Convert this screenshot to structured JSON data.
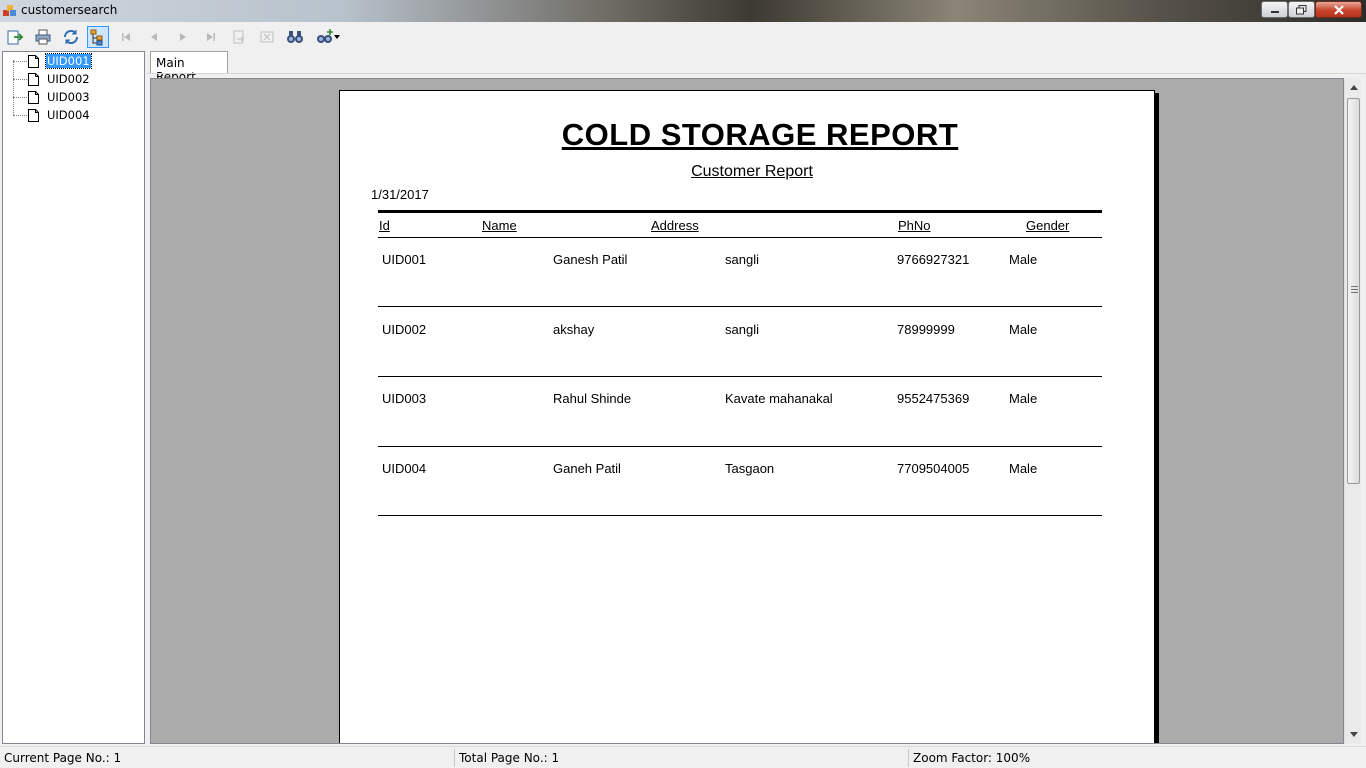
{
  "window": {
    "title": "customersearch"
  },
  "toolbar": {
    "buttons": [
      {
        "name": "export-report-icon",
        "enabled": true
      },
      {
        "name": "print-report-icon",
        "enabled": true
      },
      {
        "name": "refresh-icon",
        "enabled": true
      },
      {
        "name": "toggle-group-tree-icon",
        "enabled": true,
        "pressed": true
      },
      {
        "name": "first-page-icon",
        "enabled": false
      },
      {
        "name": "previous-page-icon",
        "enabled": false
      },
      {
        "name": "next-page-icon",
        "enabled": false
      },
      {
        "name": "last-page-icon",
        "enabled": false
      },
      {
        "name": "goto-page-icon",
        "enabled": false
      },
      {
        "name": "close-view-icon",
        "enabled": false
      },
      {
        "name": "find-text-icon",
        "enabled": true
      },
      {
        "name": "zoom-icon",
        "enabled": true
      }
    ]
  },
  "group_tree": {
    "items": [
      "UID001",
      "UID002",
      "UID003",
      "UID004"
    ],
    "selected": "UID001"
  },
  "tabs": {
    "active": "Main Report"
  },
  "report": {
    "title": "COLD STORAGE REPORT",
    "subtitle": "Customer Report",
    "date": "1/31/2017",
    "headers": {
      "id": "Id",
      "name": "Name",
      "address": "Address",
      "phno": "PhNo",
      "gender": "Gender"
    },
    "rows": [
      {
        "id": "UID001",
        "name": "Ganesh Patil",
        "address": "sangli",
        "phno": "9766927321",
        "gender": "Male"
      },
      {
        "id": "UID002",
        "name": "akshay",
        "address": "sangli",
        "phno": "78999999",
        "gender": "Male"
      },
      {
        "id": "UID003",
        "name": "Rahul Shinde",
        "address": "Kavate mahanakal",
        "phno": "9552475369",
        "gender": "Male"
      },
      {
        "id": "UID004",
        "name": "Ganeh Patil",
        "address": "Tasgaon",
        "phno": "7709504005",
        "gender": "Male"
      }
    ]
  },
  "status_bar": {
    "current_page": "Current Page No.: 1",
    "total_pages": "Total Page No.: 1",
    "zoom": "Zoom Factor: 100%"
  },
  "colors": {
    "selection": "#3399ff",
    "preview_background": "#ababab"
  }
}
